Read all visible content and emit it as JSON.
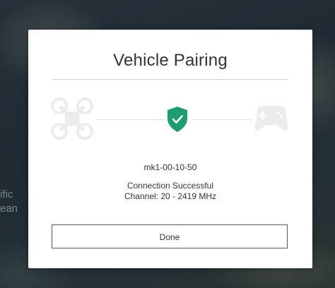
{
  "background": {
    "map_label": "ific\nean"
  },
  "dialog": {
    "title": "Vehicle Pairing",
    "device_id": "mk1-00-10-50",
    "status_line": "Connection Successful",
    "channel_line": "Channel: 20 - 2419 MHz",
    "done_label": "Done",
    "icons": {
      "vehicle": "drone-icon",
      "status": "shield-check-icon",
      "controller": "controller-icon"
    }
  },
  "colors": {
    "accent_green": "#1e9e6e",
    "icon_faded": "#ececec",
    "text": "#333333"
  }
}
